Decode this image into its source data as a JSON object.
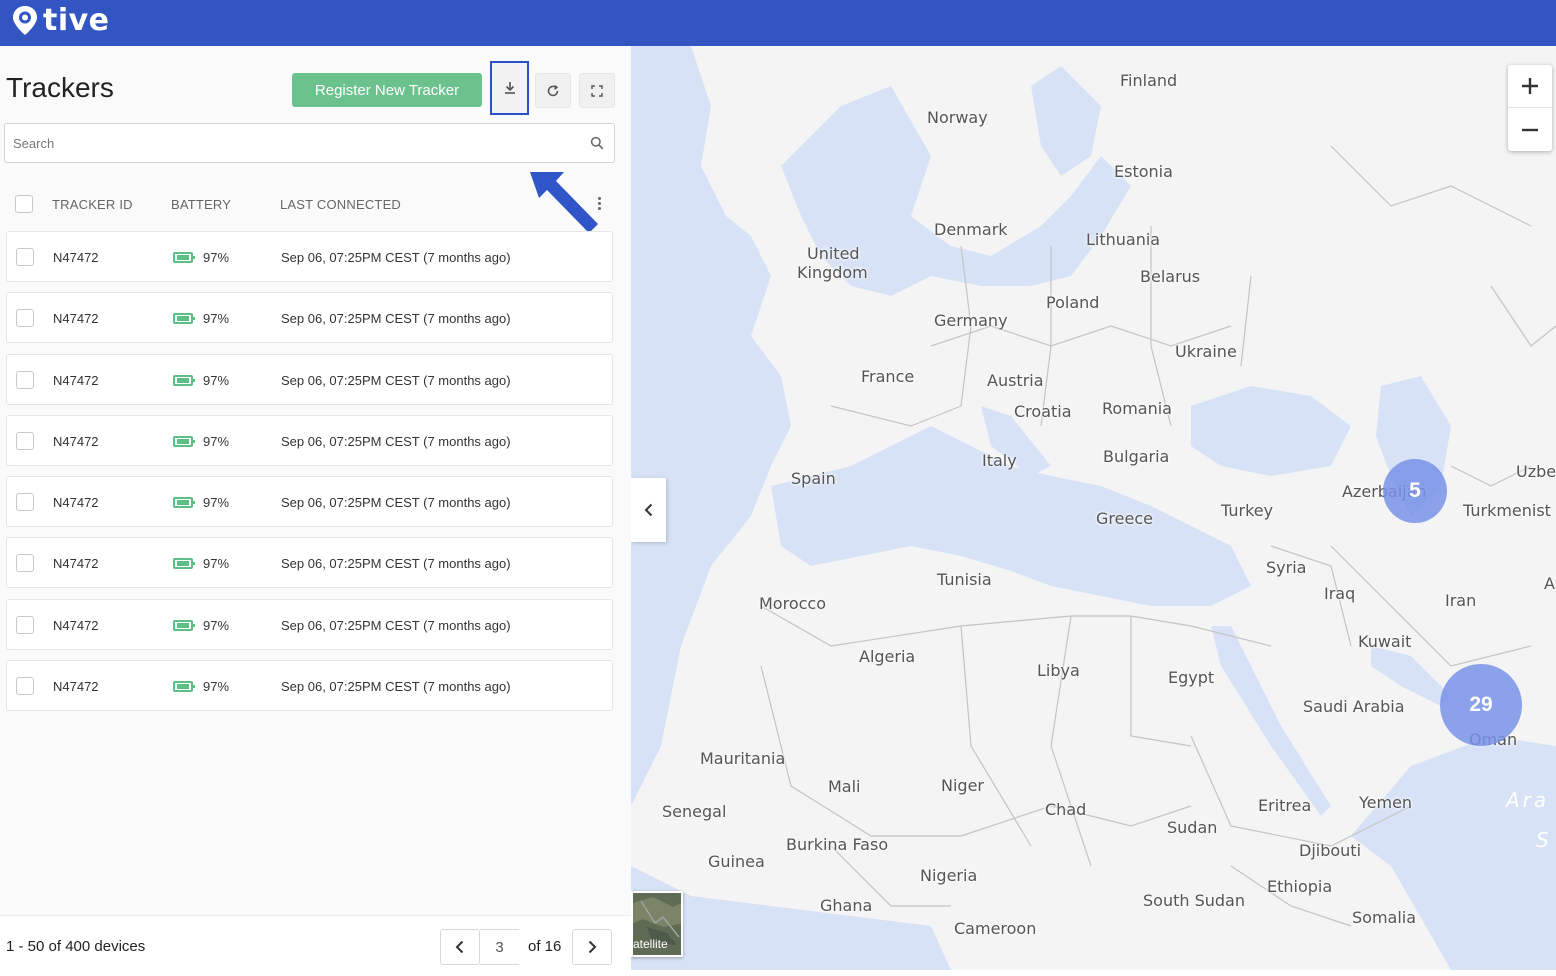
{
  "brand": {
    "name": "tive"
  },
  "panel": {
    "title": "Trackers",
    "register_label": "Register New Tracker",
    "search_placeholder": "Search"
  },
  "table": {
    "columns": [
      "TRACKER ID",
      "BATTERY",
      "LAST CONNECTED"
    ],
    "rows": [
      {
        "id": "N47472",
        "battery": "97%",
        "last_connected": "Sep 06, 07:25PM CEST (7 months ago)"
      },
      {
        "id": "N47472",
        "battery": "97%",
        "last_connected": "Sep 06, 07:25PM CEST (7 months ago)"
      },
      {
        "id": "N47472",
        "battery": "97%",
        "last_connected": "Sep 06, 07:25PM CEST (7 months ago)"
      },
      {
        "id": "N47472",
        "battery": "97%",
        "last_connected": "Sep 06, 07:25PM CEST (7 months ago)"
      },
      {
        "id": "N47472",
        "battery": "97%",
        "last_connected": "Sep 06, 07:25PM CEST (7 months ago)"
      },
      {
        "id": "N47472",
        "battery": "97%",
        "last_connected": "Sep 06, 07:25PM CEST (7 months ago)"
      },
      {
        "id": "N47472",
        "battery": "97%",
        "last_connected": "Sep 06, 07:25PM CEST (7 months ago)"
      },
      {
        "id": "N47472",
        "battery": "97%",
        "last_connected": "Sep 06, 07:25PM CEST (7 months ago)"
      }
    ]
  },
  "pagination": {
    "summary": "1 - 50 of 400 devices",
    "current_page": "3",
    "of_label": "of 16"
  },
  "map": {
    "countries": [
      "Finland",
      "Norway",
      "Estonia",
      "Denmark",
      "Lithuania",
      "United",
      "Kingdom",
      "Belarus",
      "Poland",
      "Germany",
      "Ukraine",
      "France",
      "Austria",
      "Croatia",
      "Romania",
      "Italy",
      "Bulgaria",
      "Spain",
      "Azerbaijan",
      "Uzbe",
      "Greece",
      "Turkey",
      "Turkmenist",
      "Syria",
      "Tunisia",
      "Morocco",
      "Iraq",
      "Iran",
      "A",
      "Kuwait",
      "Algeria",
      "Libya",
      "Egypt",
      "Saudi Arabia",
      "Oman",
      "Mauritania",
      "Mali",
      "Niger",
      "Chad",
      "Eritrea",
      "Yemen",
      "Senegal",
      "Sudan",
      "Burkina Faso",
      "Djibouti",
      "Guinea",
      "Nigeria",
      "Ethiopia",
      "Ghana",
      "South Sudan",
      "Somalia",
      "Cameroon",
      "Ara",
      "S"
    ],
    "clusters": [
      {
        "count": "5"
      },
      {
        "count": "29"
      }
    ],
    "satellite_label": "atellite",
    "colors": {
      "land": "#f4f4f4",
      "water": "#d8e2f6",
      "cluster": "#8aa2ea",
      "border": "#c4c4c4"
    }
  },
  "colors": {
    "brand": "#3355c2",
    "register": "#6cc28d",
    "battery": "#5cbf86",
    "highlight": "#2b50c8"
  }
}
